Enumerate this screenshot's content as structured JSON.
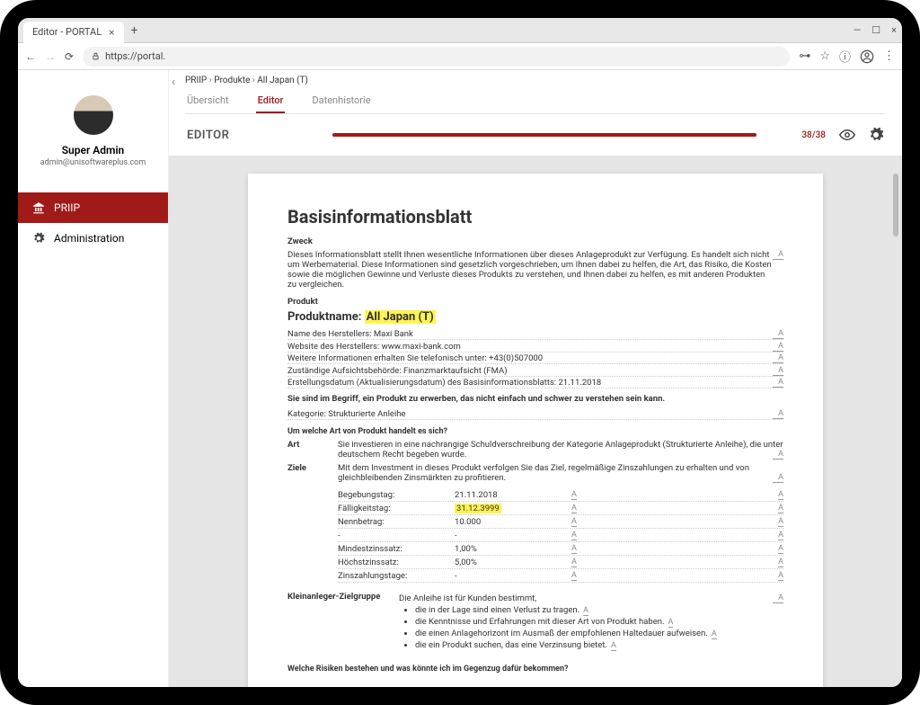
{
  "browser": {
    "tab_title": "Editor - PORTAL",
    "url": "https://portal."
  },
  "user": {
    "name": "Super Admin",
    "email": "admin@unisoftwareplus.com"
  },
  "nav": {
    "priip": "PRIIP",
    "admin": "Administration"
  },
  "breadcrumb": {
    "a": "PRIIP",
    "b": "Produkte",
    "c": "All Japan (T)"
  },
  "tabs": {
    "overview": "Übersicht",
    "editor": "Editor",
    "history": "Datenhistorie"
  },
  "editor": {
    "title": "EDITOR",
    "progress": "38/38"
  },
  "doc": {
    "title": "Basisinformationsblatt",
    "zweck_h": "Zweck",
    "zweck_body": "Dieses Informationsblatt stellt Ihnen wesentliche Informationen über dieses Anlageprodukt zur Verfügung. Es handelt sich nicht um Werbematerial. Diese Informationen sind gesetzlich vorgeschrieben, um Ihnen dabei zu helfen, die Art, das Risiko, die Kosten sowie die möglichen Gewinne und Verluste dieses Produkts zu verstehen, und Ihnen dabei zu helfen, es mit anderen Produkten zu vergleichen.",
    "produkt_h": "Produkt",
    "product_name_label": "Produktname:",
    "product_name_value": "All Japan (T)",
    "maker_label": "Name des Herstellers:",
    "maker_value": "Maxi Bank",
    "website_label": "Website des Herstellers:",
    "website_value": "www.maxi-bank.com",
    "phone_label": "Weitere Informationen erhalten Sie telefonisch unter:",
    "phone_value": "+43(0)507000",
    "authority_label": "Zuständige Aufsichtsbehörde:",
    "authority_value": "Finanzmarktaufsicht (FMA)",
    "date_label": "Erstellungsdatum (Aktualisierungsdatum) des Basisinformationsblatts:",
    "date_value": "21.11.2018",
    "warning": "Sie sind im Begriff, ein Produkt zu erwerben, das nicht einfach und schwer zu verstehen sein kann.",
    "cat_label": "Kategorie:",
    "cat_value": "Strukturierte Anleihe",
    "q1": "Um welche Art von Produkt handelt es sich?",
    "art_label": "Art",
    "art_body": "Sie investieren in eine nachrangige Schuldverschreibung der Kategorie Anlageprodukt (Strukturierte Anleihe), die unter deutschem Recht begeben wurde.",
    "ziele_label": "Ziele",
    "ziele_body": "Mit dem Investment in dieses Produkt verfolgen Sie das Ziel, regelmäßige Zinszahlungen zu erhalten und von gleichbleibenden Zinsmärkten zu profitieren.",
    "kv": [
      {
        "k": "Begebungstag:",
        "v": "21.11.2018",
        "hl": false
      },
      {
        "k": "Fälligkeitstag:",
        "v": "31.12.3999",
        "hl": true
      },
      {
        "k": "Nennbetrag:",
        "v": "10.000",
        "hl": false
      },
      {
        "k": "-",
        "v": "-",
        "hl": false
      },
      {
        "k": "Mindestzinssatz:",
        "v": "1,00%",
        "hl": false
      },
      {
        "k": "Höchstzinssatz:",
        "v": "5,00%",
        "hl": false
      },
      {
        "k": "Zinszahlungstage:",
        "v": "-",
        "hl": false
      }
    ],
    "target_label": "Kleinanleger-Zielgruppe",
    "target_intro": "Die Anleihe ist für Kunden bestimmt,",
    "target_items": [
      "die in der Lage sind einen Verlust zu tragen.",
      "die Kenntnisse und Erfahrungen mit dieser Art von Produkt haben.",
      "die einen Anlagehorizont im Ausmaß der empfohlenen Haltedauer aufweisen.",
      "die ein Produkt suchen, das eine Verzinsung bietet."
    ],
    "q2": "Welche Risiken bestehen und was könnte ich im Gegenzug dafür bekommen?"
  },
  "glyph": {
    "annot": "A"
  }
}
